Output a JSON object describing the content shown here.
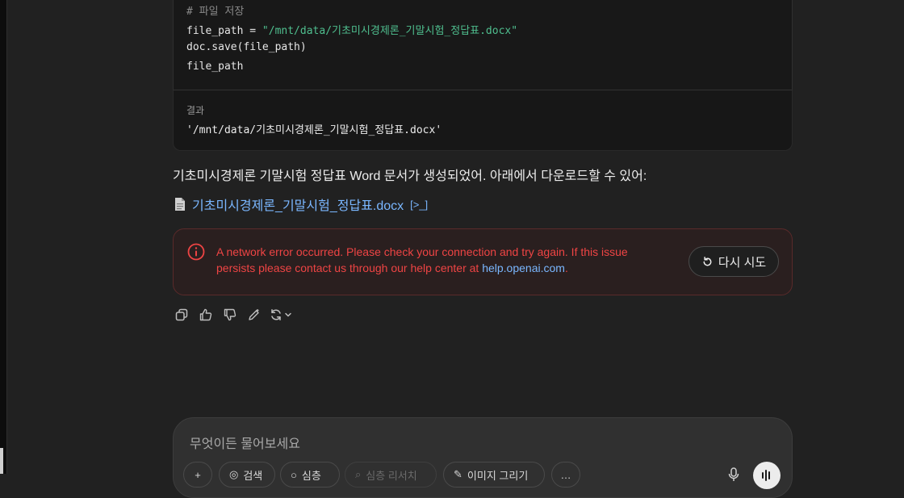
{
  "code": {
    "comment": "# 파일 저장",
    "line1_var": "file_path = ",
    "line1_str": "\"/mnt/data/기초미시경제론_기말시험_정답표.docx\"",
    "line2": "doc.save(file_path)",
    "line3": "file_path"
  },
  "result": {
    "label": "결과",
    "value": "'/mnt/data/기초미시경제론_기말시험_정답표.docx'"
  },
  "answer": {
    "text": "기초미시경제론 기말시험 정답표 Word 문서가 생성되었어. 아래에서 다운로드할 수 있어:",
    "file_icon": "document-icon",
    "file_link": "기초미시경제론_기말시험_정답표.docx",
    "ext_icon_text": "[>_]"
  },
  "error": {
    "message_before": "A network error occurred. Please check your connection and try again. If this issue persists please contact us through our help center at ",
    "link": "help.openai.com",
    "message_after": ".",
    "retry_label": "다시 시도",
    "color": "#ef4444"
  },
  "actions": {
    "icons": [
      "copy-icon",
      "thumbs-up-icon",
      "thumbs-down-icon",
      "edit-icon",
      "regenerate-icon",
      "chevron-down-icon"
    ]
  },
  "composer": {
    "placeholder": "무엇이든 물어보세요",
    "pills": [
      {
        "label": "+",
        "icon": "plus-icon"
      },
      {
        "label": "검색",
        "icon": "globe-icon"
      },
      {
        "label": "심층",
        "icon": "search-icon"
      },
      {
        "label": "심층 리서치",
        "icon": "telescope-icon"
      },
      {
        "label": "이미지 그리기",
        "icon": "brush-icon"
      },
      {
        "label": "…",
        "icon": "more-icon"
      }
    ]
  },
  "colors": {
    "link": "#7ab7ff",
    "string": "#4fbf8f",
    "background": "#212121"
  }
}
